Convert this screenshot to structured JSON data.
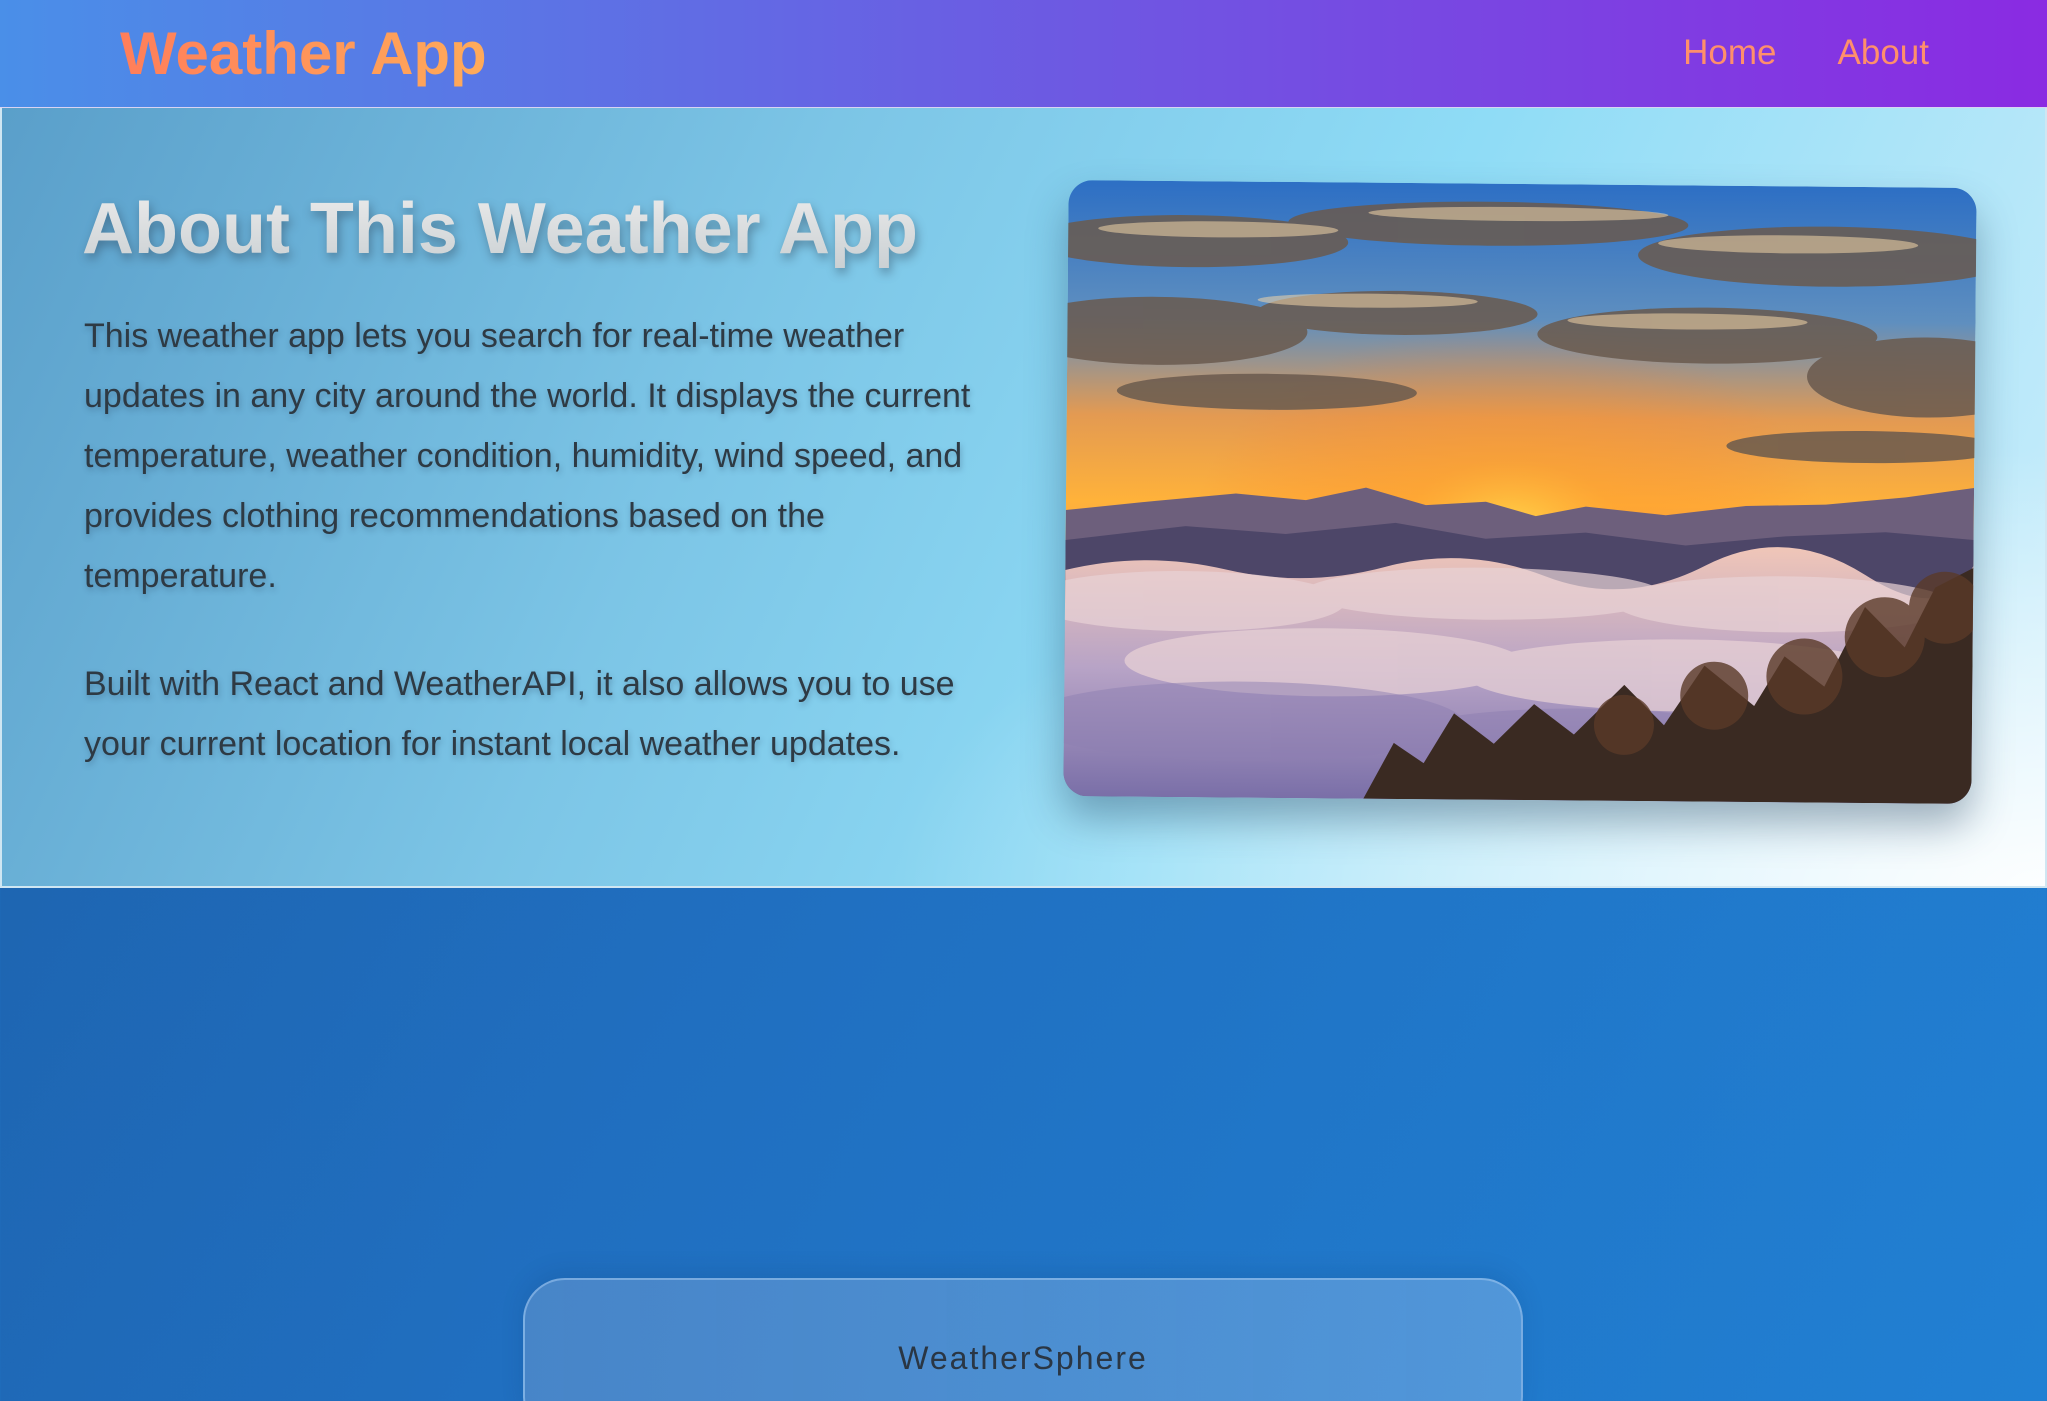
{
  "header": {
    "brand": "Weather App",
    "nav": [
      {
        "label": "Home"
      },
      {
        "label": "About"
      }
    ]
  },
  "about": {
    "title": "About This Weather App",
    "paragraphs": [
      "This weather app lets you search for real-time weather updates in any city around the world. It displays the current temperature, weather condition, humidity, wind speed, and provides clothing recommendations based on the temperature.",
      "Built with React and WeatherAPI, it also allows you to use your current location for instant local weather updates."
    ],
    "image": {
      "alt": "Sunrise over a sea of clouds"
    }
  },
  "footer": {
    "brand": "WeatherSphere"
  },
  "colors": {
    "header_gradient_start": "#4a8fe8",
    "header_gradient_end": "#8a2be2",
    "brand_accent": "#ff8c59",
    "nav_link": "#ff8f6b",
    "page_background": "#206fc0",
    "body_text": "#2e3a44"
  }
}
